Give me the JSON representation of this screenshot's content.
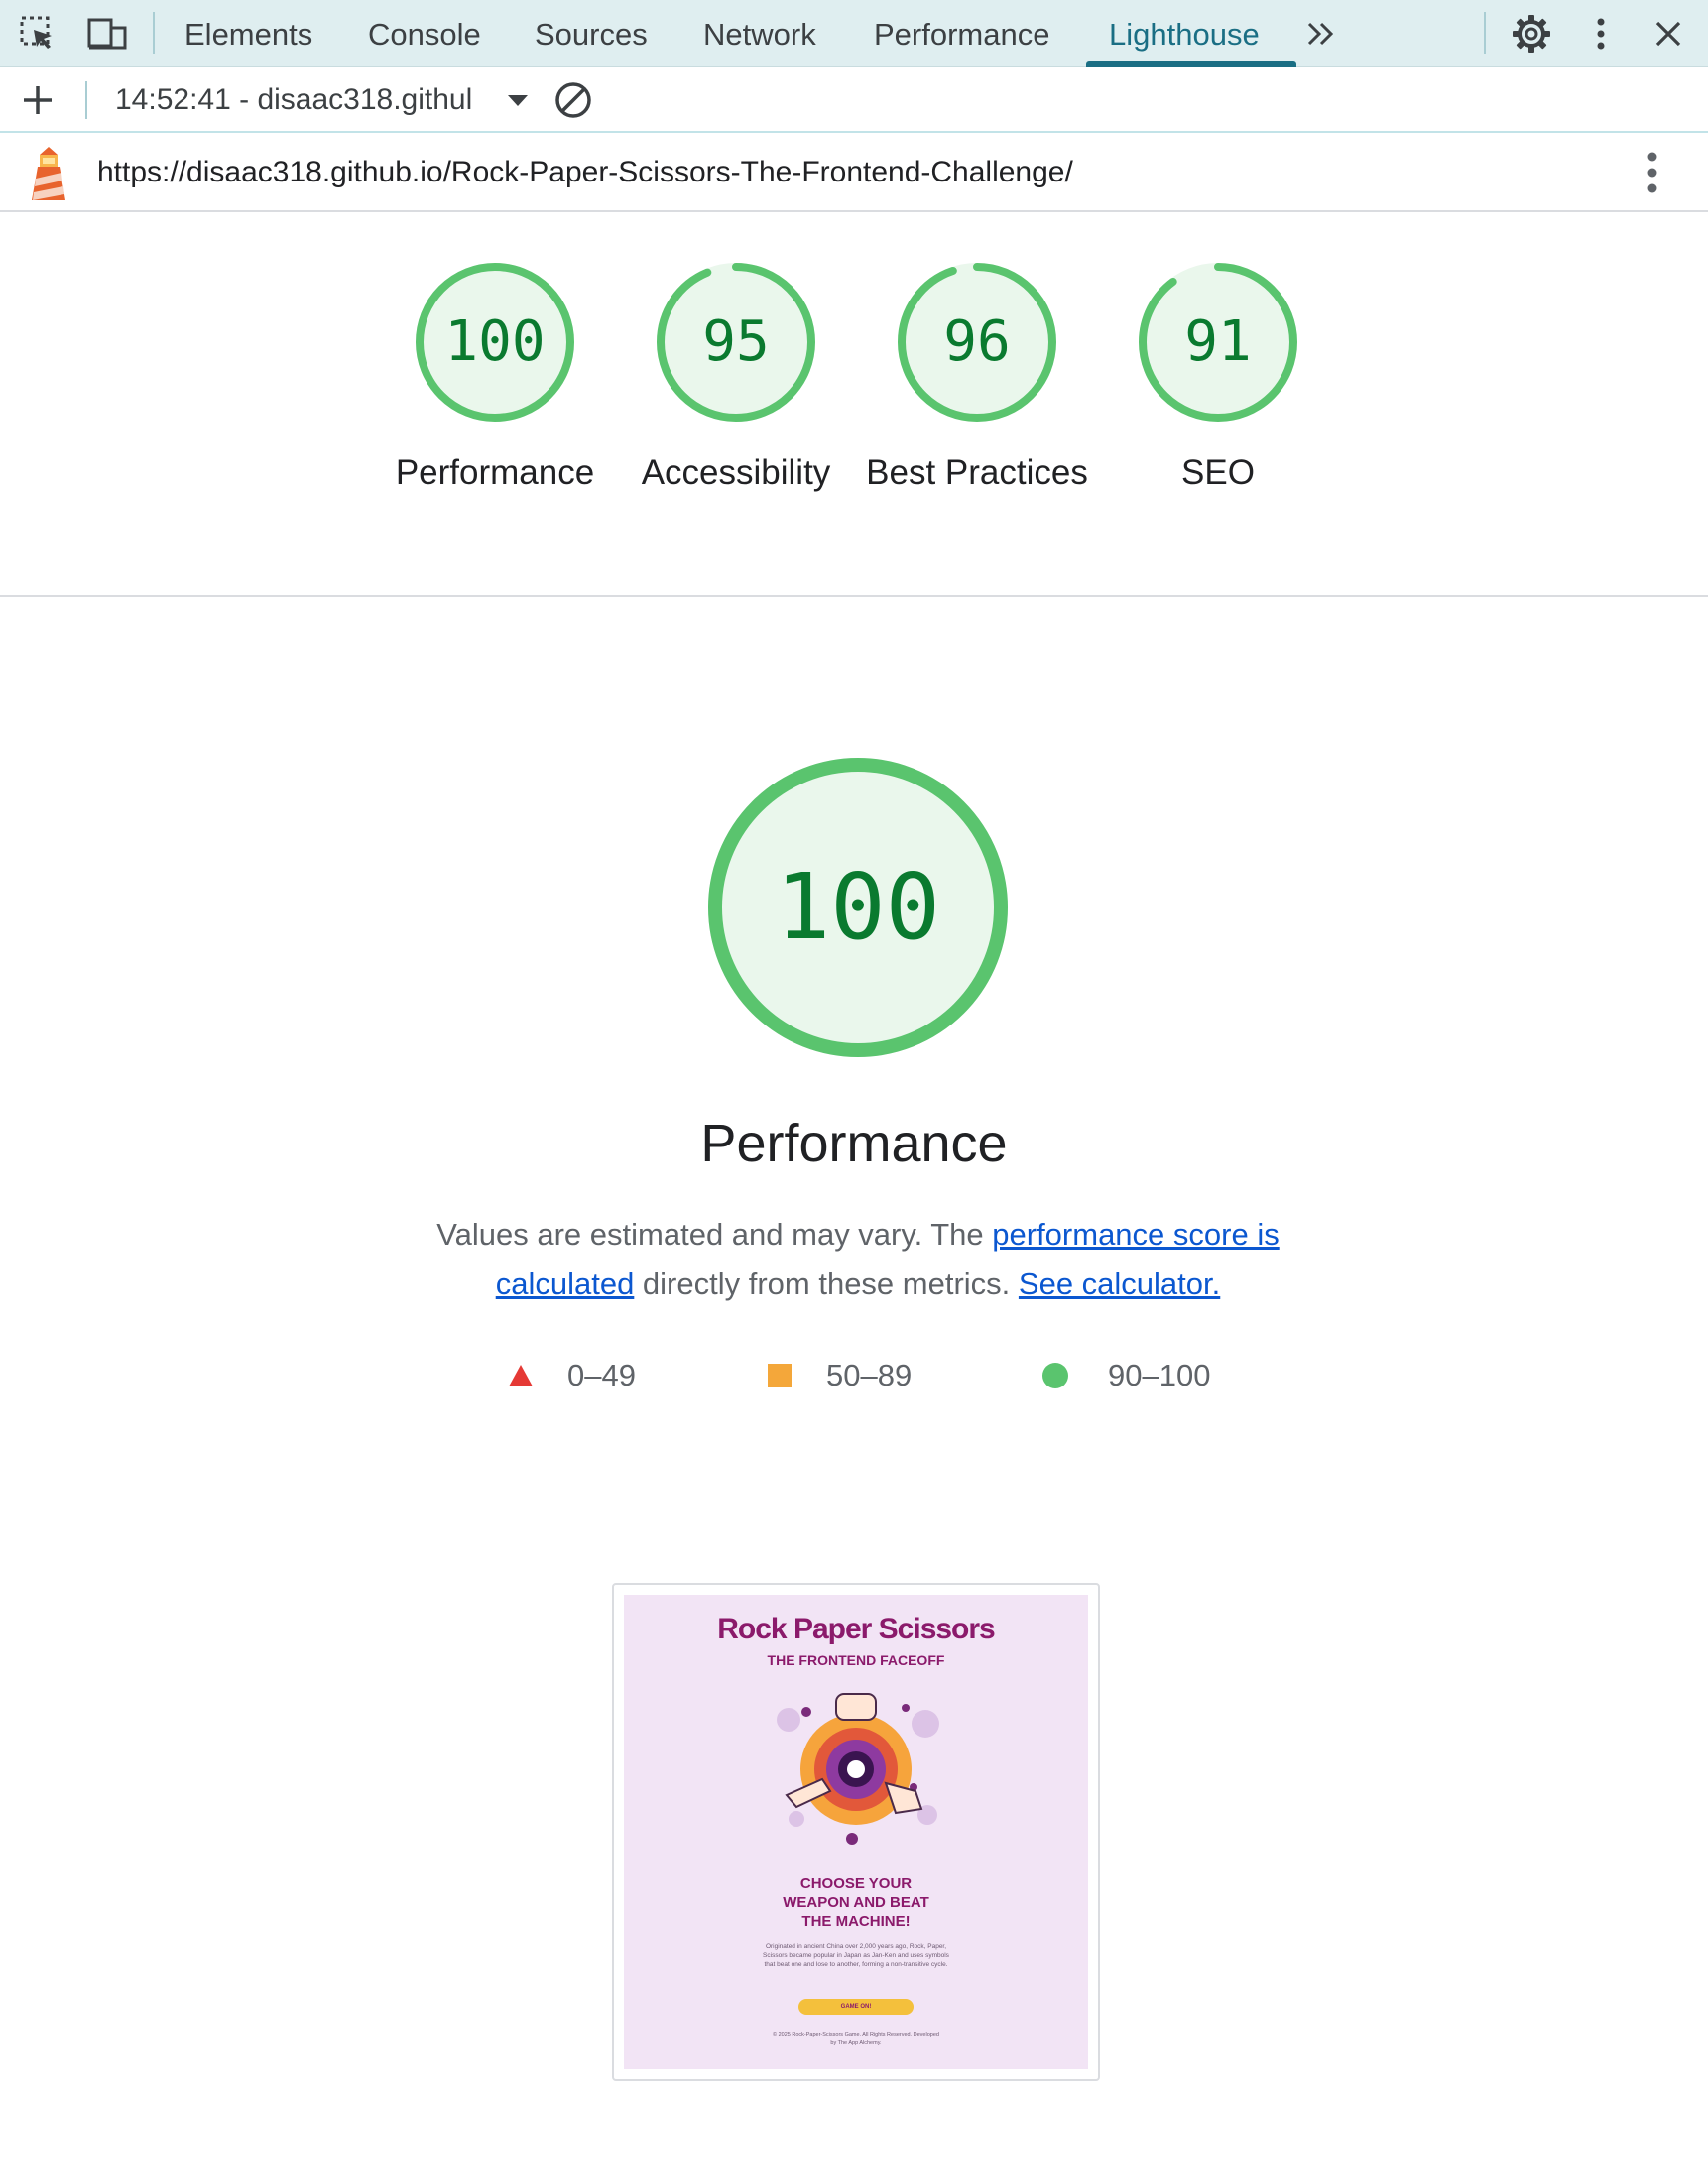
{
  "devtools": {
    "tabs": [
      {
        "label": "Elements"
      },
      {
        "label": "Console"
      },
      {
        "label": "Sources"
      },
      {
        "label": "Network"
      },
      {
        "label": "Performance"
      },
      {
        "label": "Lighthouse",
        "active": true
      }
    ],
    "overflow_icon": "chevron-double-right-icon",
    "active_accent": "#1a6e84"
  },
  "report_bar": {
    "selected_report": "14:52:41 - disaac318.githul",
    "add_icon": "plus-icon",
    "clear_icon": "block-icon"
  },
  "url_bar": {
    "url": "https://disaac318.github.io/Rock-Paper-Scissors-The-Frontend-Challenge/",
    "logo_icon": "lighthouse-icon"
  },
  "scores": [
    {
      "value": "100",
      "score": 100,
      "label": "Performance"
    },
    {
      "value": "95",
      "score": 95,
      "label": "Accessibility"
    },
    {
      "value": "96",
      "score": 96,
      "label": "Best Practices"
    },
    {
      "value": "91",
      "score": 91,
      "label": "SEO"
    }
  ],
  "performance": {
    "score": "100",
    "score_value": 100,
    "title": "Performance",
    "desc_pre": "Values are estimated and may vary. The ",
    "desc_link1": "performance score is calculated",
    "desc_mid": " directly from these metrics. ",
    "desc_link2": "See calculator."
  },
  "legend": [
    {
      "label": "0–49",
      "shape": "triangle",
      "color": "#e53935"
    },
    {
      "label": "50–89",
      "shape": "square",
      "color": "#f4a73a"
    },
    {
      "label": "90–100",
      "shape": "circle",
      "color": "#5ac46e"
    }
  ],
  "colors": {
    "pass": "#0a7a2f",
    "pass_ring": "#5ac46e",
    "pass_fill": "#eaf7ec"
  },
  "thumbnail": {
    "title": "Rock Paper Scissors",
    "subtitle": "THE FRONTEND FACEOFF",
    "headline_1": "CHOOSE YOUR",
    "headline_2": "WEAPON AND BEAT",
    "headline_3": "THE MACHINE!",
    "body": "Originated in ancient China over 2,000 years ago, Rock, Paper, Scissors became popular in Japan as Jan-Ken and uses symbols that beat one and lose to another, forming a non-transitive cycle.",
    "button": "GAME ON!",
    "footer": "© 2025 Rock-Paper-Scissors Game. All Rights Reserved. Developed by The App Alchemy."
  }
}
